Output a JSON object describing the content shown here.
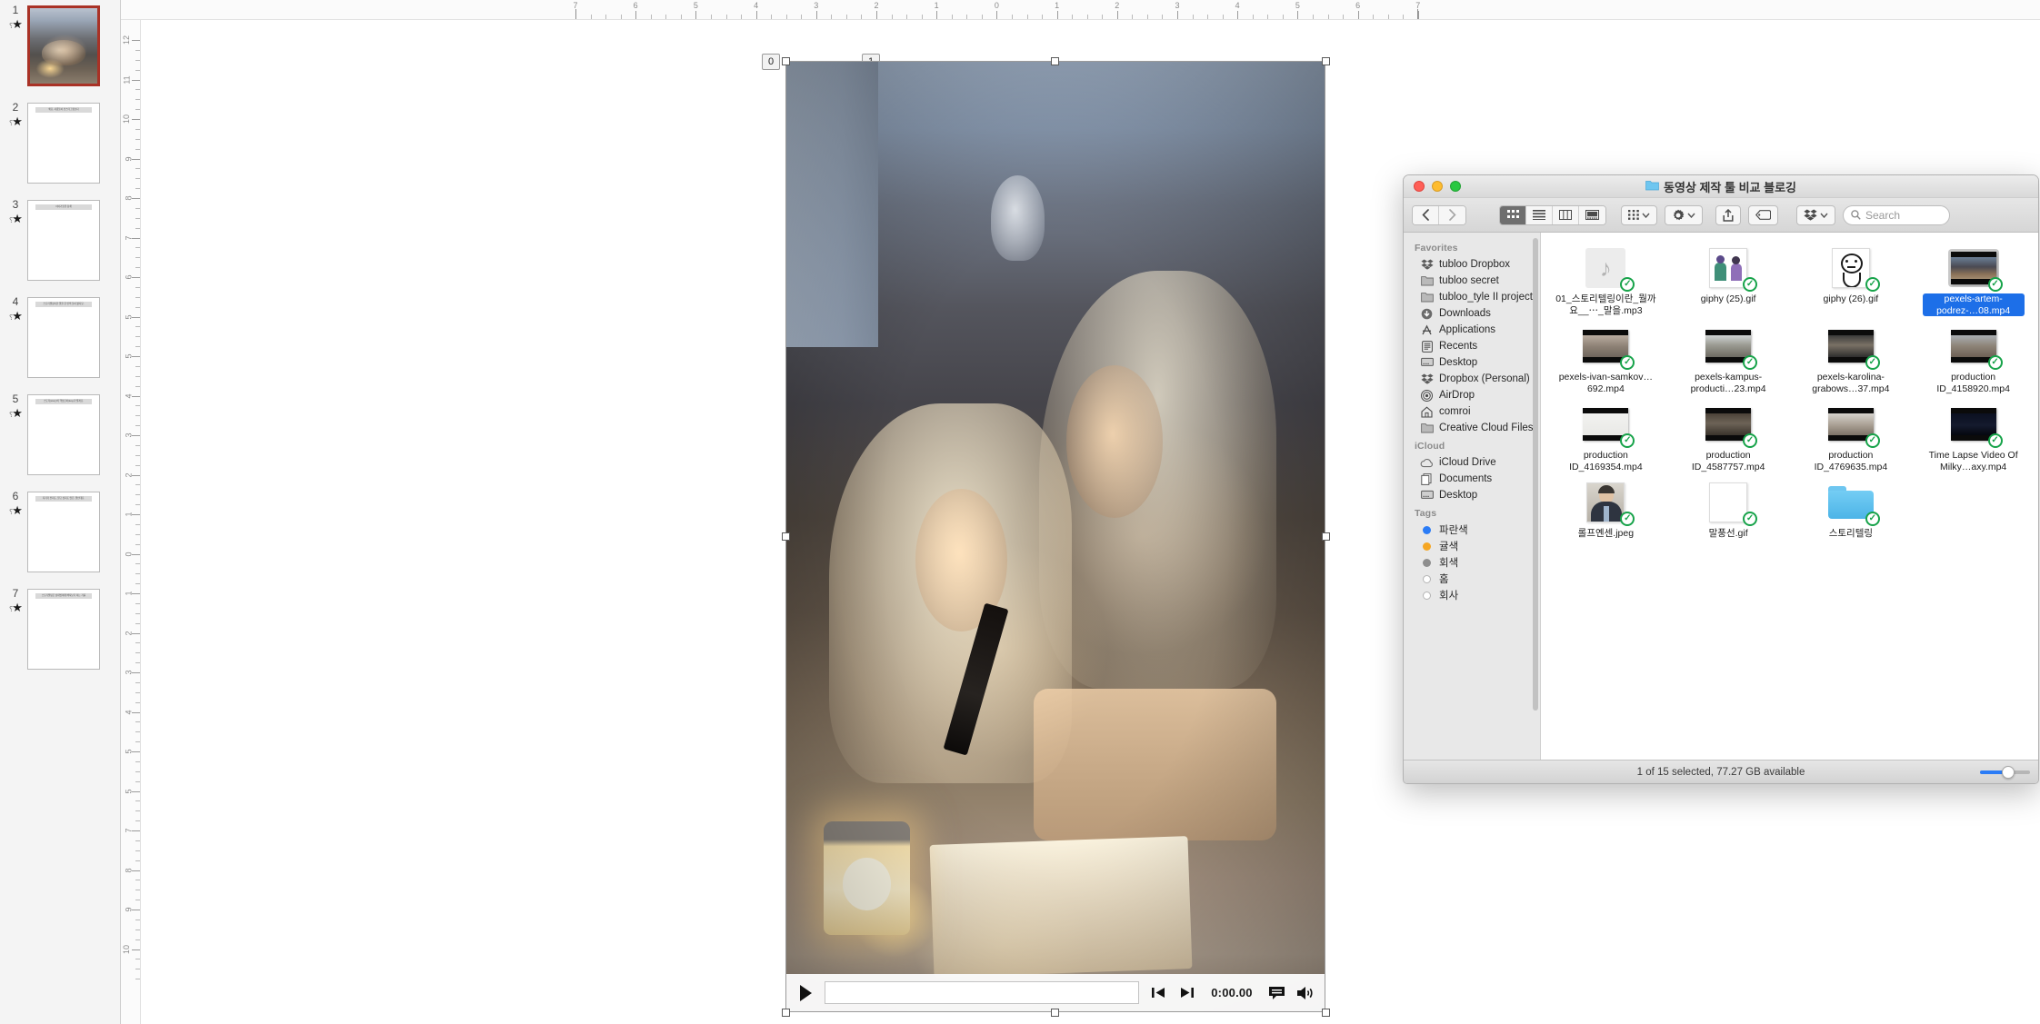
{
  "app": {
    "name": "PowerPoint slide editor with macOS Finder"
  },
  "thumbnails": {
    "panel_name": "slide-thumbnail-panel",
    "slides": [
      {
        "number": "1",
        "title": "",
        "selected": true,
        "has_photo": true
      },
      {
        "number": "2",
        "title": "왜요, 사람들이 인스타그램보다",
        "selected": false,
        "has_photo": false
      },
      {
        "number": "3",
        "title": "이야기들을 통해",
        "selected": false,
        "has_photo": false
      },
      {
        "number": "4",
        "title": "스토리텔링이란 말을 한 번씩 들어 봤지요.",
        "selected": false,
        "has_photo": false
      },
      {
        "number": "5",
        "title": "스토리(story)의 핵심단어(key)가 뭘까요.",
        "selected": false,
        "has_photo": false
      },
      {
        "number": "6",
        "title": "자기가 믿지도, 알고 싶지도 않은, 말인데요.",
        "selected": false,
        "has_photo": false
      },
      {
        "number": "7",
        "title": "스토리텔링은 상대방에게 빠져보기 하는 거를",
        "selected": false,
        "has_photo": false
      }
    ]
  },
  "rulers": {
    "horizontal_labels": [
      "7",
      "6",
      "5",
      "4",
      "3",
      "2",
      "1",
      "0",
      "1",
      "2",
      "3",
      "4",
      "5",
      "6",
      "7"
    ],
    "vertical_labels": [
      "12",
      "11",
      "10",
      "9",
      "8",
      "7",
      "6",
      "5",
      "5",
      "4",
      "3",
      "2",
      "1",
      "0",
      "1",
      "2",
      "3",
      "4",
      "5",
      "5",
      "7",
      "8",
      "9",
      "10"
    ]
  },
  "slide": {
    "audio_object": {
      "name": "audio-sound-object",
      "badge_left": "0",
      "badge_right": "1",
      "animation_icon": "lightning-bolt-icon"
    },
    "video": {
      "name": "video-placeholder",
      "selected": true,
      "controls": {
        "play_label": "▶",
        "time": "0:00.00",
        "prev_frame_icon": "step-backward-icon",
        "next_frame_icon": "step-forward-icon",
        "caption_icon": "closed-caption-icon",
        "volume_icon": "volume-icon"
      }
    }
  },
  "finder": {
    "window_title": "동영상 제작 툴 비교 블로깅",
    "titlebar": {
      "close": "close-button",
      "minimize": "minimize-button",
      "maximize": "maximize-button"
    },
    "toolbar": {
      "back_icon": "chevron-left-icon",
      "forward_icon": "chevron-right-icon",
      "view_icon_grid": "icon-view-icon",
      "view_list": "list-view-icon",
      "view_column": "column-view-icon",
      "view_gallery": "gallery-view-icon",
      "group_icon": "group-by-icon",
      "action_icon": "gear-icon",
      "share_icon": "share-icon",
      "tag_icon": "tag-icon",
      "dropbox_icon": "dropbox-icon",
      "search_placeholder": "Search",
      "search_value": ""
    },
    "sidebar": {
      "sections": [
        {
          "heading": "Favorites",
          "items": [
            {
              "label": "tubloo Dropbox",
              "icon": "dropbox-icon"
            },
            {
              "label": "tubloo secret",
              "icon": "folder-icon"
            },
            {
              "label": "tubloo_tyle II project",
              "icon": "folder-icon"
            },
            {
              "label": "Downloads",
              "icon": "downloads-icon"
            },
            {
              "label": "Applications",
              "icon": "applications-icon"
            },
            {
              "label": "Recents",
              "icon": "recents-icon"
            },
            {
              "label": "Desktop",
              "icon": "desktop-icon"
            },
            {
              "label": "Dropbox (Personal)",
              "icon": "dropbox-icon"
            },
            {
              "label": "AirDrop",
              "icon": "airdrop-icon"
            },
            {
              "label": "comroi",
              "icon": "home-icon"
            },
            {
              "label": "Creative Cloud Files",
              "icon": "folder-icon"
            }
          ]
        },
        {
          "heading": "iCloud",
          "items": [
            {
              "label": "iCloud Drive",
              "icon": "cloud-icon"
            },
            {
              "label": "Documents",
              "icon": "documents-icon"
            },
            {
              "label": "Desktop",
              "icon": "desktop-icon"
            }
          ]
        },
        {
          "heading": "Tags",
          "items": [
            {
              "label": "파란색",
              "icon": "tag-dot",
              "color": "#2b7cf6"
            },
            {
              "label": "귤색",
              "icon": "tag-dot",
              "color": "#f5a623"
            },
            {
              "label": "회색",
              "icon": "tag-dot",
              "color": "#8e8e8e"
            },
            {
              "label": "홈",
              "icon": "tag-dot",
              "color": "#ffffff"
            },
            {
              "label": "회사",
              "icon": "tag-dot",
              "color": "#ffffff"
            }
          ]
        }
      ]
    },
    "files": [
      {
        "name": "01_스토리텔링이란_뭘까요__⋯_말을.mp3",
        "kind": "audio",
        "selected": false,
        "synced": true
      },
      {
        "name": "giphy (25).gif",
        "kind": "gif-people",
        "selected": false,
        "synced": true
      },
      {
        "name": "giphy (26).gif",
        "kind": "gif-face",
        "selected": false,
        "synced": true
      },
      {
        "name": "pexels-artem-podrez-…08.mp4",
        "kind": "video-night",
        "selected": true,
        "synced": true
      },
      {
        "name": "pexels-ivan-samkov…692.mp4",
        "kind": "video-tablet",
        "selected": false,
        "synced": true
      },
      {
        "name": "pexels-kampus-producti…23.mp4",
        "kind": "video-camera",
        "selected": false,
        "synced": true
      },
      {
        "name": "pexels-karolina-grabows…37.mp4",
        "kind": "video-head",
        "selected": false,
        "synced": true
      },
      {
        "name": "production ID_4158920.mp4",
        "kind": "video-family",
        "selected": false,
        "synced": true
      },
      {
        "name": "production ID_4169354.mp4",
        "kind": "video-confetti",
        "selected": false,
        "synced": true
      },
      {
        "name": "production ID_4587757.mp4",
        "kind": "video-man",
        "selected": false,
        "synced": true
      },
      {
        "name": "production ID_4769635.mp4",
        "kind": "video-sofa",
        "selected": false,
        "synced": true
      },
      {
        "name": "Time Lapse Video Of Milky…axy.mp4",
        "kind": "video-sky",
        "selected": false,
        "synced": true
      },
      {
        "name": "롤프옌센.jpeg",
        "kind": "photo-portrait",
        "selected": false,
        "synced": true
      },
      {
        "name": "말풍선.gif",
        "kind": "gif-blank",
        "selected": false,
        "synced": true
      },
      {
        "name": "스토리텔링",
        "kind": "folder",
        "selected": false,
        "synced": true
      }
    ],
    "status": {
      "text": "1 of 15 selected, 77.27 GB available",
      "zoom_slider": "icon-size-slider"
    }
  },
  "colors": {
    "selection_blue": "#1d6fe8",
    "dropbox_green": "#17a34a",
    "slide_selected_border": "#a93226",
    "folder_blue": "#4cb4e7"
  }
}
